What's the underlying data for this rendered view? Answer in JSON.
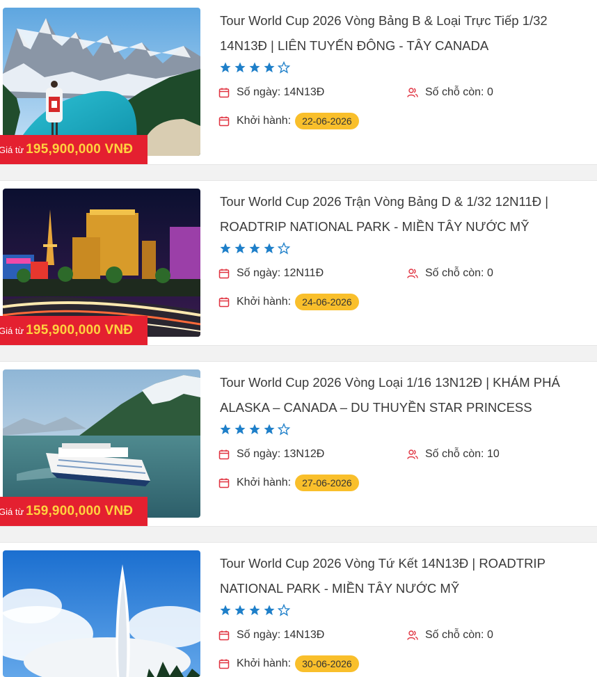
{
  "price_from_label": "Giá từ",
  "labels": {
    "days": "Số ngày:",
    "seats": "Số chỗ còn:",
    "departure": "Khởi hành:"
  },
  "colors": {
    "price_bg": "#e42030",
    "price_amount": "#ffd23f",
    "star": "#1e7fc9",
    "icon_red": "#e0313f",
    "badge": "#f9bf2b"
  },
  "tours": [
    {
      "title": "Tour World Cup 2026 Vòng Bảng B & Loại Trực Tiếp 1/32 14N13Đ | LIÊN TUYẾN ĐÔNG - TÂY CANADA",
      "price": "195,900,000 VNĐ",
      "rating": 4,
      "rating_max": 5,
      "days": "14N13Đ",
      "seats": "0",
      "departure": "22-06-2026",
      "image": "canada-lake-mountains"
    },
    {
      "title": "Tour World Cup 2026 Trận Vòng Bảng D & 1/32 12N11Đ | ROADTRIP NATIONAL PARK - MIỀN TÂY NƯỚC MỸ",
      "price": "195,900,000 VNĐ",
      "rating": 4,
      "rating_max": 5,
      "days": "12N11Đ",
      "seats": "0",
      "departure": "24-06-2026",
      "image": "las-vegas-night"
    },
    {
      "title": "Tour World Cup 2026 Vòng Loại 1/16 13N12Đ | KHÁM PHÁ ALASKA – CANADA – DU THUYỀN STAR PRINCESS",
      "price": "159,900,000 VNĐ",
      "rating": 4,
      "rating_max": 5,
      "days": "13N12Đ",
      "seats": "10",
      "departure": "27-06-2026",
      "image": "alaska-cruise"
    },
    {
      "title": "Tour World Cup 2026 Vòng Tứ Kết 14N13Đ | ROADTRIP NATIONAL PARK - MIỀN TÂY NƯỚC MỸ",
      "price": "",
      "rating": 4,
      "rating_max": 5,
      "days": "14N13Đ",
      "seats": "0",
      "departure": "30-06-2026",
      "image": "geyser"
    }
  ]
}
